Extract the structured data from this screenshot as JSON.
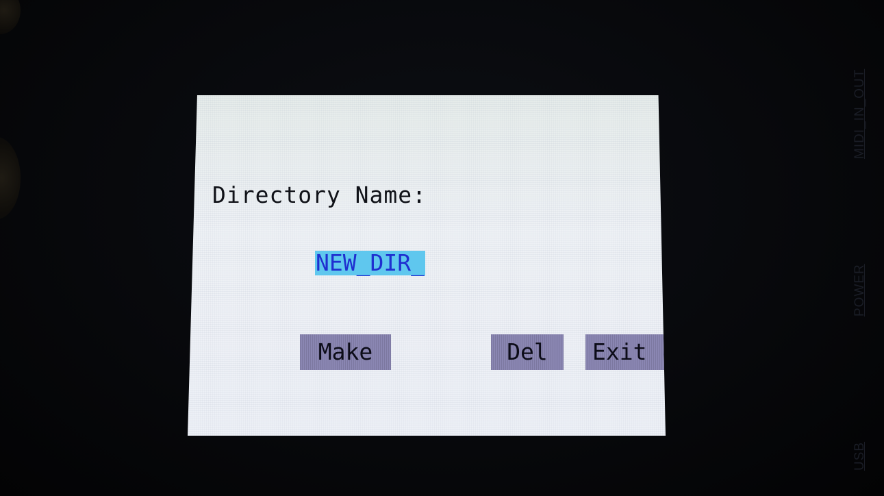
{
  "screen": {
    "label": "Directory Name:",
    "name_value": "NEW_DIR_"
  },
  "buttons": {
    "make": "Make",
    "del": "Del",
    "exit": "Exit"
  },
  "device_labels": {
    "midi": "MIDI_IN_OUT",
    "power": "POWER",
    "usb": "USB"
  },
  "colors": {
    "screen_bg": "#eef1f5",
    "field_highlight": "#5fc7ee",
    "field_text": "#1f2fd0",
    "button_bg": "#8a86b2"
  }
}
